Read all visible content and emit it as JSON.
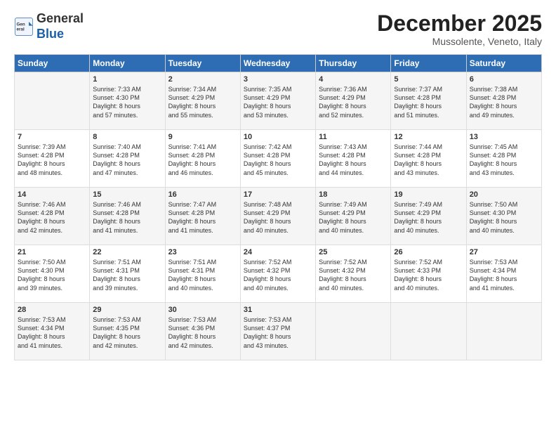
{
  "logo": {
    "line1": "General",
    "line2": "Blue"
  },
  "header": {
    "month": "December 2025",
    "location": "Mussolente, Veneto, Italy"
  },
  "weekdays": [
    "Sunday",
    "Monday",
    "Tuesday",
    "Wednesday",
    "Thursday",
    "Friday",
    "Saturday"
  ],
  "weeks": [
    [
      {
        "day": "",
        "sunrise": "",
        "sunset": "",
        "daylight": ""
      },
      {
        "day": "1",
        "sunrise": "Sunrise: 7:33 AM",
        "sunset": "Sunset: 4:30 PM",
        "daylight": "Daylight: 8 hours and 57 minutes."
      },
      {
        "day": "2",
        "sunrise": "Sunrise: 7:34 AM",
        "sunset": "Sunset: 4:29 PM",
        "daylight": "Daylight: 8 hours and 55 minutes."
      },
      {
        "day": "3",
        "sunrise": "Sunrise: 7:35 AM",
        "sunset": "Sunset: 4:29 PM",
        "daylight": "Daylight: 8 hours and 53 minutes."
      },
      {
        "day": "4",
        "sunrise": "Sunrise: 7:36 AM",
        "sunset": "Sunset: 4:29 PM",
        "daylight": "Daylight: 8 hours and 52 minutes."
      },
      {
        "day": "5",
        "sunrise": "Sunrise: 7:37 AM",
        "sunset": "Sunset: 4:28 PM",
        "daylight": "Daylight: 8 hours and 51 minutes."
      },
      {
        "day": "6",
        "sunrise": "Sunrise: 7:38 AM",
        "sunset": "Sunset: 4:28 PM",
        "daylight": "Daylight: 8 hours and 49 minutes."
      }
    ],
    [
      {
        "day": "7",
        "sunrise": "Sunrise: 7:39 AM",
        "sunset": "Sunset: 4:28 PM",
        "daylight": "Daylight: 8 hours and 48 minutes."
      },
      {
        "day": "8",
        "sunrise": "Sunrise: 7:40 AM",
        "sunset": "Sunset: 4:28 PM",
        "daylight": "Daylight: 8 hours and 47 minutes."
      },
      {
        "day": "9",
        "sunrise": "Sunrise: 7:41 AM",
        "sunset": "Sunset: 4:28 PM",
        "daylight": "Daylight: 8 hours and 46 minutes."
      },
      {
        "day": "10",
        "sunrise": "Sunrise: 7:42 AM",
        "sunset": "Sunset: 4:28 PM",
        "daylight": "Daylight: 8 hours and 45 minutes."
      },
      {
        "day": "11",
        "sunrise": "Sunrise: 7:43 AM",
        "sunset": "Sunset: 4:28 PM",
        "daylight": "Daylight: 8 hours and 44 minutes."
      },
      {
        "day": "12",
        "sunrise": "Sunrise: 7:44 AM",
        "sunset": "Sunset: 4:28 PM",
        "daylight": "Daylight: 8 hours and 43 minutes."
      },
      {
        "day": "13",
        "sunrise": "Sunrise: 7:45 AM",
        "sunset": "Sunset: 4:28 PM",
        "daylight": "Daylight: 8 hours and 43 minutes."
      }
    ],
    [
      {
        "day": "14",
        "sunrise": "Sunrise: 7:46 AM",
        "sunset": "Sunset: 4:28 PM",
        "daylight": "Daylight: 8 hours and 42 minutes."
      },
      {
        "day": "15",
        "sunrise": "Sunrise: 7:46 AM",
        "sunset": "Sunset: 4:28 PM",
        "daylight": "Daylight: 8 hours and 41 minutes."
      },
      {
        "day": "16",
        "sunrise": "Sunrise: 7:47 AM",
        "sunset": "Sunset: 4:28 PM",
        "daylight": "Daylight: 8 hours and 41 minutes."
      },
      {
        "day": "17",
        "sunrise": "Sunrise: 7:48 AM",
        "sunset": "Sunset: 4:29 PM",
        "daylight": "Daylight: 8 hours and 40 minutes."
      },
      {
        "day": "18",
        "sunrise": "Sunrise: 7:49 AM",
        "sunset": "Sunset: 4:29 PM",
        "daylight": "Daylight: 8 hours and 40 minutes."
      },
      {
        "day": "19",
        "sunrise": "Sunrise: 7:49 AM",
        "sunset": "Sunset: 4:29 PM",
        "daylight": "Daylight: 8 hours and 40 minutes."
      },
      {
        "day": "20",
        "sunrise": "Sunrise: 7:50 AM",
        "sunset": "Sunset: 4:30 PM",
        "daylight": "Daylight: 8 hours and 40 minutes."
      }
    ],
    [
      {
        "day": "21",
        "sunrise": "Sunrise: 7:50 AM",
        "sunset": "Sunset: 4:30 PM",
        "daylight": "Daylight: 8 hours and 39 minutes."
      },
      {
        "day": "22",
        "sunrise": "Sunrise: 7:51 AM",
        "sunset": "Sunset: 4:31 PM",
        "daylight": "Daylight: 8 hours and 39 minutes."
      },
      {
        "day": "23",
        "sunrise": "Sunrise: 7:51 AM",
        "sunset": "Sunset: 4:31 PM",
        "daylight": "Daylight: 8 hours and 40 minutes."
      },
      {
        "day": "24",
        "sunrise": "Sunrise: 7:52 AM",
        "sunset": "Sunset: 4:32 PM",
        "daylight": "Daylight: 8 hours and 40 minutes."
      },
      {
        "day": "25",
        "sunrise": "Sunrise: 7:52 AM",
        "sunset": "Sunset: 4:32 PM",
        "daylight": "Daylight: 8 hours and 40 minutes."
      },
      {
        "day": "26",
        "sunrise": "Sunrise: 7:52 AM",
        "sunset": "Sunset: 4:33 PM",
        "daylight": "Daylight: 8 hours and 40 minutes."
      },
      {
        "day": "27",
        "sunrise": "Sunrise: 7:53 AM",
        "sunset": "Sunset: 4:34 PM",
        "daylight": "Daylight: 8 hours and 41 minutes."
      }
    ],
    [
      {
        "day": "28",
        "sunrise": "Sunrise: 7:53 AM",
        "sunset": "Sunset: 4:34 PM",
        "daylight": "Daylight: 8 hours and 41 minutes."
      },
      {
        "day": "29",
        "sunrise": "Sunrise: 7:53 AM",
        "sunset": "Sunset: 4:35 PM",
        "daylight": "Daylight: 8 hours and 42 minutes."
      },
      {
        "day": "30",
        "sunrise": "Sunrise: 7:53 AM",
        "sunset": "Sunset: 4:36 PM",
        "daylight": "Daylight: 8 hours and 42 minutes."
      },
      {
        "day": "31",
        "sunrise": "Sunrise: 7:53 AM",
        "sunset": "Sunset: 4:37 PM",
        "daylight": "Daylight: 8 hours and 43 minutes."
      },
      {
        "day": "",
        "sunrise": "",
        "sunset": "",
        "daylight": ""
      },
      {
        "day": "",
        "sunrise": "",
        "sunset": "",
        "daylight": ""
      },
      {
        "day": "",
        "sunrise": "",
        "sunset": "",
        "daylight": ""
      }
    ]
  ]
}
